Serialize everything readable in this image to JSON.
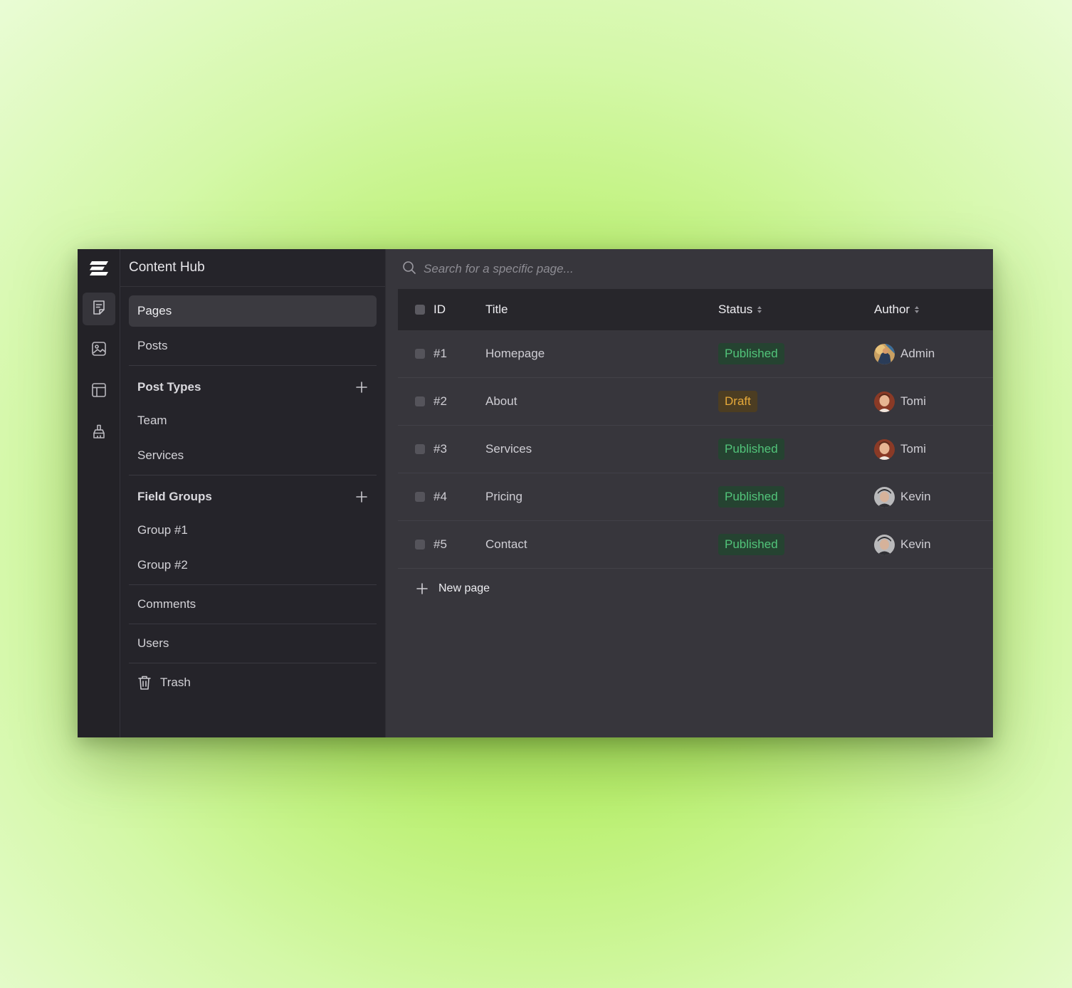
{
  "app": {
    "title": "Content Hub"
  },
  "rail": {
    "items": [
      {
        "icon": "document-icon",
        "active": true
      },
      {
        "icon": "image-icon",
        "active": false
      },
      {
        "icon": "layout-icon",
        "active": false
      },
      {
        "icon": "brush-icon",
        "active": false
      }
    ]
  },
  "nav": {
    "pages": "Pages",
    "posts": "Posts",
    "post_types": {
      "label": "Post Types",
      "items": [
        "Team",
        "Services"
      ]
    },
    "field_groups": {
      "label": "Field Groups",
      "items": [
        "Group #1",
        "Group #2"
      ]
    },
    "comments": "Comments",
    "users": "Users",
    "trash": "Trash"
  },
  "search": {
    "placeholder": "Search for a specific page..."
  },
  "table": {
    "headers": {
      "id": "ID",
      "title": "Title",
      "status": "Status",
      "author": "Author"
    },
    "rows": [
      {
        "id": "#1",
        "title": "Homepage",
        "status": "Published",
        "author": "Admin"
      },
      {
        "id": "#2",
        "title": "About",
        "status": "Draft",
        "author": "Tomi"
      },
      {
        "id": "#3",
        "title": "Services",
        "status": "Published",
        "author": "Tomi"
      },
      {
        "id": "#4",
        "title": "Pricing",
        "status": "Published",
        "author": "Kevin"
      },
      {
        "id": "#5",
        "title": "Contact",
        "status": "Published",
        "author": "Kevin"
      }
    ]
  },
  "new_page": "New page",
  "colors": {
    "published": "#52c47a",
    "draft": "#e6a93a",
    "accent_bg": "#37363c"
  }
}
